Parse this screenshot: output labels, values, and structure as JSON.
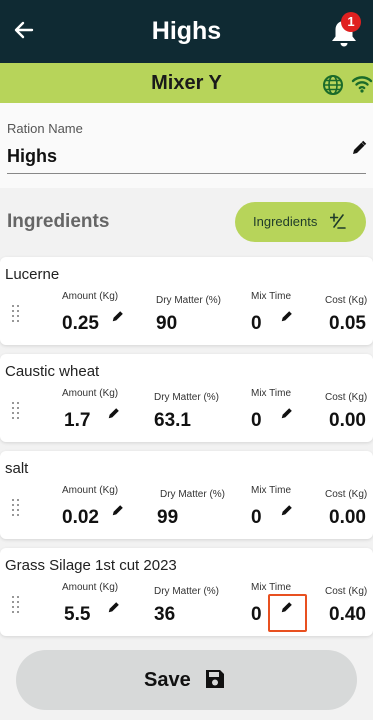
{
  "header": {
    "title": "Highs",
    "notification_count": "1",
    "back_icon": "arrow-left-icon",
    "bell_icon": "bell-icon"
  },
  "mixer": {
    "name": "Mixer Y",
    "status_icons": [
      "globe-icon",
      "wifi-icon"
    ]
  },
  "ration": {
    "label": "Ration Name",
    "value": "Highs"
  },
  "ingredients_section": {
    "heading": "Ingredients",
    "button_label": "Ingredients"
  },
  "ingredients": [
    {
      "name": "Lucerne",
      "amount_label": "Amount (Kg)",
      "amount": "0.25",
      "dm_label": "Dry Matter (%)",
      "dm": "90",
      "mix_label": "Mix Time",
      "mix": "0",
      "cost_label": "Cost (Kg)",
      "cost": "0.05"
    },
    {
      "name": "Caustic wheat",
      "amount_label": "Amount (Kg)",
      "amount": "1.7",
      "dm_label": "Dry Matter (%)",
      "dm": "63.1",
      "mix_label": "Mix Time",
      "mix": "0",
      "cost_label": "Cost (Kg)",
      "cost": "0.00"
    },
    {
      "name": "salt",
      "amount_label": "Amount (Kg)",
      "amount": "0.02",
      "dm_label": "Dry Matter (%)",
      "dm": "99",
      "mix_label": "Mix Time",
      "mix": "0",
      "cost_label": "Cost (Kg)",
      "cost": "0.00"
    },
    {
      "name": "Grass Silage 1st cut 2023",
      "amount_label": "Amount (Kg)",
      "amount": "5.5",
      "dm_label": "Dry Matter (%)",
      "dm": "36",
      "mix_label": "Mix Time",
      "mix": "0",
      "cost_label": "Cost (Kg)",
      "cost": "0.40"
    }
  ],
  "footer": {
    "save_label": "Save"
  },
  "colors": {
    "header_bg": "#0f2a33",
    "accent_green": "#b7d45a",
    "badge_red": "#e02020",
    "highlight": "#e85020"
  }
}
